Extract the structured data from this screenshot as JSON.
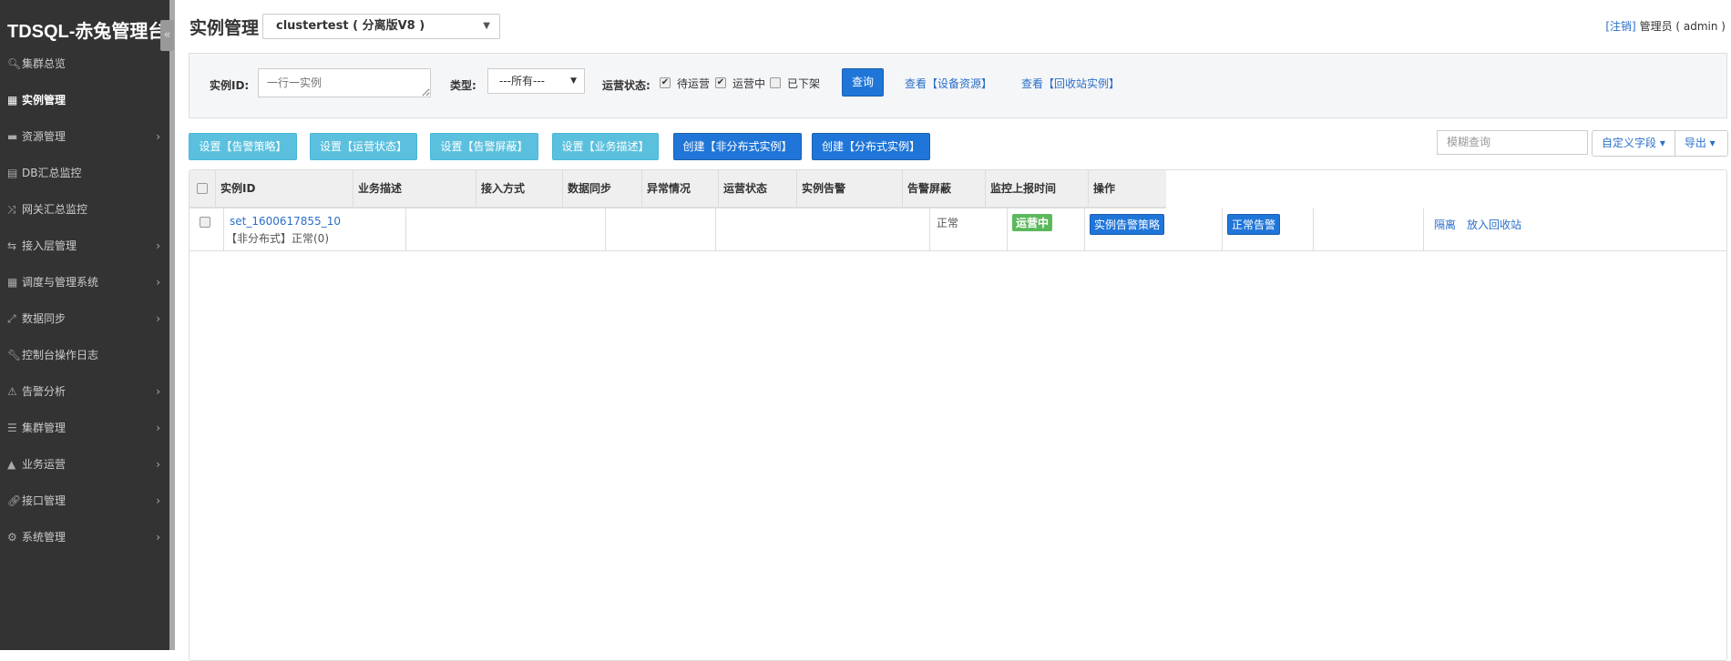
{
  "sidebar": {
    "logo": "TDSQL-赤兔管理台",
    "collapse_icon": "«",
    "items": [
      {
        "label": "集群总览",
        "icon": "🔍︎",
        "chevron": false
      },
      {
        "label": "实例管理",
        "icon": "▦",
        "chevron": false,
        "active": true
      },
      {
        "label": "资源管理",
        "icon": "▬",
        "chevron": true
      },
      {
        "label": "DB汇总监控",
        "icon": "▤",
        "chevron": false
      },
      {
        "label": "网关汇总监控",
        "icon": "⤨",
        "chevron": false
      },
      {
        "label": "接入层管理",
        "icon": "⇆",
        "chevron": true
      },
      {
        "label": "调度与管理系统",
        "icon": "▦",
        "chevron": true
      },
      {
        "label": "数据同步",
        "icon": "⤢",
        "chevron": true
      },
      {
        "label": "控制台操作日志",
        "icon": "🔧︎",
        "chevron": false
      },
      {
        "label": "告警分析",
        "icon": "⚠",
        "chevron": true
      },
      {
        "label": "集群管理",
        "icon": "☰",
        "chevron": true
      },
      {
        "label": "业务运营",
        "icon": "▲",
        "chevron": true
      },
      {
        "label": "接口管理",
        "icon": "🔗︎",
        "chevron": true
      },
      {
        "label": "系统管理",
        "icon": "⚙",
        "chevron": true
      }
    ]
  },
  "header": {
    "title": "实例管理",
    "cluster_select": "clustertest ( 分离版V8 )",
    "logout": "[注销]",
    "user": "管理员 ( admin )"
  },
  "filter": {
    "instance_id_label": "实例ID:",
    "instance_id_placeholder": "一行一实例",
    "type_label": "类型:",
    "type_value": "---所有---",
    "status_label": "运营状态:",
    "statuses": [
      {
        "label": "待运营",
        "checked": true
      },
      {
        "label": "运营中",
        "checked": true
      },
      {
        "label": "已下架",
        "checked": false
      }
    ],
    "query_button": "查询",
    "link_devices": "查看【设备资源】",
    "link_recycle": "查看【回收站实例】"
  },
  "toolbar": {
    "buttons": [
      "设置【告警策略】",
      "设置【运营状态】",
      "设置【告警屏蔽】",
      "设置【业务描述】",
      "创建【非分布式实例】",
      "创建【分布式实例】"
    ],
    "fuzzy_placeholder": "模糊查询",
    "custom_fields": "自定义字段 ▾",
    "export": "导出 ▾"
  },
  "table": {
    "columns": [
      "实例ID",
      "业务描述",
      "接入方式",
      "数据同步",
      "异常情况",
      "运营状态",
      "实例告警",
      "告警屏蔽",
      "监控上报时间",
      "操作"
    ],
    "rows": [
      {
        "id": "set_1600617855_10",
        "subtitle": "【非分布式】正常(0)",
        "abnormal": "正常",
        "status": "运营中",
        "alarm_policy": "实例告警策略",
        "alarm_mask": "正常告警",
        "actions": [
          "隔离",
          "放入回收站"
        ]
      }
    ]
  }
}
